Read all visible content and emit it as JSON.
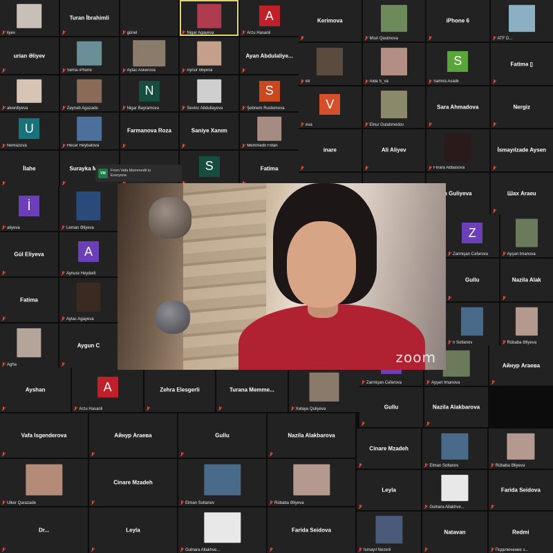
{
  "app": {
    "watermark": "zoom"
  },
  "chat_toast": {
    "avatar": "VM",
    "line1": "From Vafa Memmedli to",
    "line2": "Everyone"
  },
  "colors": {
    "tile": "#222222",
    "active_border": "#e3d66b",
    "mute": "#e0483e"
  },
  "top_grid": [
    {
      "kind": "thumb",
      "caption": "liyev",
      "img": "#c8c0b6"
    },
    {
      "kind": "name",
      "name": "Turan İbrahimli",
      "caption": ""
    },
    {
      "kind": "caption",
      "caption": "günel"
    },
    {
      "kind": "thumb",
      "caption": "Nigar Agayeva",
      "img": "#b03a4e",
      "active": true
    },
    {
      "kind": "letter",
      "letter": "A",
      "bg": "#c0202a",
      "caption": "Arzu Hasanli"
    },
    {
      "kind": "name",
      "name": "urian Əliyev",
      "caption": ""
    },
    {
      "kind": "thumb",
      "caption": "Sema iPhone",
      "img": "#6a8f96"
    },
    {
      "kind": "thumb",
      "caption": "Aytac Askerova",
      "img": "#8a7b6a",
      "wide": true
    },
    {
      "kind": "thumb",
      "caption": "Aynur Əliyeva",
      "img": "#c4a08c"
    },
    {
      "kind": "name",
      "name": "Ayan Abdulaliye...",
      "caption": ""
    },
    {
      "kind": "thumb",
      "caption": "alverdiyeva",
      "img": "#d8c4b4"
    },
    {
      "kind": "thumb",
      "caption": "Zeynəb Agazade",
      "img": "#8a6b5a"
    },
    {
      "kind": "letter",
      "letter": "N",
      "bg": "#164d3e",
      "caption": "Nigar Bayramova"
    },
    {
      "kind": "thumb",
      "caption": "Sevinc Abdullayeva",
      "img": "#cfcfcf"
    },
    {
      "kind": "letter",
      "letter": "S",
      "bg": "#c84a1e",
      "caption": "Şebnem Rustemova"
    },
    {
      "kind": "letter",
      "letter": "U",
      "bg": "#17727a",
      "caption": "Nemazova"
    },
    {
      "kind": "thumb",
      "caption": "Hecər Heybətova",
      "img": "#4c6f9c"
    },
    {
      "kind": "name",
      "name": "Farmanova Roza",
      "caption": ""
    },
    {
      "kind": "name",
      "name": "Saniye Xanım",
      "caption": ""
    },
    {
      "kind": "thumb",
      "caption": "Memmedli Fidan",
      "img": "#a58b82"
    },
    {
      "kind": "name",
      "name": "İlahe",
      "caption": ""
    },
    {
      "kind": "name",
      "name": "Surayka Murad",
      "caption": ""
    },
    {
      "kind": "caption",
      "caption": ""
    },
    {
      "kind": "letter",
      "letter": "S",
      "bg": "#164d3e",
      "caption": ""
    },
    {
      "kind": "name",
      "name": "Fatima",
      "caption": ""
    }
  ],
  "right_grid": [
    {
      "kind": "name",
      "name": "Kerimova",
      "caption": ""
    },
    {
      "kind": "thumb",
      "caption": "Misri Qasimova",
      "img": "#6d8a5a"
    },
    {
      "kind": "name",
      "name": "iPhone 6",
      "caption": ""
    },
    {
      "kind": "thumb",
      "caption": "ATF D...",
      "img": "#8bb0c4"
    },
    {
      "kind": "thumb",
      "caption": "eti",
      "img": "#5b4a3e"
    },
    {
      "kind": "thumb",
      "caption": "Aida S_va",
      "img": "#b28f82"
    },
    {
      "kind": "letter",
      "letter": "S",
      "bg": "#5aa53a",
      "caption": "Samira Asadli"
    },
    {
      "kind": "name",
      "name": "Fatimə ▯",
      "caption": ""
    },
    {
      "kind": "letter",
      "letter": "V",
      "bg": "#d4502a",
      "caption": "eva"
    },
    {
      "kind": "thumb",
      "caption": "Elnur Gulahmedov",
      "img": "#8a8a6a"
    },
    {
      "kind": "name",
      "name": "Sara Ahmadova",
      "caption": ""
    },
    {
      "kind": "name",
      "name": "Nergiz",
      "caption": ""
    },
    {
      "kind": "name",
      "name": "inare",
      "caption": ""
    },
    {
      "kind": "name",
      "name": "Ali Aliyev",
      "caption": ""
    },
    {
      "kind": "thumb",
      "caption": "Finara Abbasova",
      "img": "#2a1a1a"
    },
    {
      "kind": "name",
      "name": "İsmayılzade Aysen",
      "caption": ""
    },
    {
      "kind": "caption",
      "caption": ""
    },
    {
      "kind": "caption",
      "caption": ""
    },
    {
      "kind": "name",
      "name": "n Guliyeva",
      "caption": ""
    },
    {
      "kind": "name",
      "name": "Шах Araeu",
      "caption": ""
    }
  ],
  "left_strip": [
    {
      "kind": "letter",
      "letter": "İ",
      "bg": "#6b3fb8",
      "caption": "aliyeva"
    },
    {
      "kind": "thumb",
      "caption": "Leman Əliyeva",
      "img": "#2a4a7a"
    },
    {
      "kind": "name",
      "name": "Gül Eliyeva",
      "caption": ""
    },
    {
      "kind": "letter",
      "letter": "A",
      "bg": "#6b3fb8",
      "caption": "Aynure Heyderli"
    },
    {
      "kind": "name",
      "name": "Fatima",
      "caption": ""
    },
    {
      "kind": "thumb",
      "caption": "Aytac Agayeva",
      "img": "#3a2a22"
    },
    {
      "kind": "thumb",
      "caption": "Agha",
      "img": "#b4a49a"
    },
    {
      "kind": "name",
      "name": "Aygun C",
      "caption": ""
    }
  ],
  "right_strip": [
    {
      "kind": "letter",
      "letter": "Z",
      "bg": "#6b3fb8",
      "caption": "Zarmişan Cəfərova"
    },
    {
      "kind": "thumb",
      "caption": "Ayşən İmanova",
      "img": "#6a7a5a"
    },
    {
      "kind": "name",
      "name": "Gullu",
      "caption": ""
    },
    {
      "kind": "name",
      "name": "Nazila Alak",
      "caption": ""
    },
    {
      "kind": "thumb",
      "caption": "n Soltanov",
      "img": "#4a6a8a"
    },
    {
      "kind": "thumb",
      "caption": "Rübaba Əliyeva",
      "img": "#b49a8e"
    }
  ],
  "bottom_rows": {
    "row1": [
      {
        "kind": "name",
        "name": "Ayshan",
        "caption": ""
      },
      {
        "kind": "letter",
        "letter": "A",
        "bg": "#c0202a",
        "caption": "Arzu Hasanli"
      },
      {
        "kind": "name",
        "name": "Zehra Elesgerli",
        "caption": ""
      },
      {
        "kind": "name",
        "name": "Turana Memme...",
        "caption": ""
      },
      {
        "kind": "thumb",
        "caption": "Xətayə Quliyeva",
        "img": "#8a7a6a"
      }
    ],
    "row1_right": [
      {
        "kind": "letter",
        "letter": "Z",
        "bg": "#6b3fb8",
        "caption": "Zarmişan Cəfərova"
      },
      {
        "kind": "thumb",
        "caption": "Ayşən İmanova",
        "img": "#6a7a5a"
      },
      {
        "kind": "name",
        "name": "Aйнур Araeвa",
        "caption": ""
      },
      {
        "kind": "name",
        "name": "Gullu",
        "caption": ""
      },
      {
        "kind": "name",
        "name": "Nazila Alakbarova",
        "caption": ""
      }
    ],
    "row2": [
      {
        "kind": "name",
        "name": "Vafa Isgenderova",
        "caption": ""
      },
      {
        "kind": "name",
        "name": "Aйнур Araeвa",
        "caption": ""
      },
      {
        "kind": "name",
        "name": "Gullu",
        "caption": ""
      },
      {
        "kind": "name",
        "name": "Nazila Alakbarova",
        "caption": ""
      }
    ],
    "row2_right": [
      {
        "kind": "name",
        "name": "Cinare Mzadeh",
        "caption": ""
      },
      {
        "kind": "thumb",
        "caption": "Elman Soltanov",
        "img": "#4a6a8a"
      },
      {
        "kind": "thumb",
        "caption": "Rübaba Əliyeva",
        "img": "#b49a8e"
      }
    ],
    "row3": [
      {
        "kind": "thumb",
        "caption": "Ulker Qarazade",
        "img": "#b48a78"
      },
      {
        "kind": "name",
        "name": "Cinare Mzadeh",
        "caption": ""
      },
      {
        "kind": "thumb",
        "caption": "Elman Soltanov",
        "img": "#4a6a8a"
      },
      {
        "kind": "thumb",
        "caption": "Rübaba Əliyeva",
        "img": "#b49a8e"
      }
    ],
    "row3_right": [
      {
        "kind": "name",
        "name": "Leyla",
        "caption": ""
      },
      {
        "kind": "thumb",
        "caption": "Gulnara Allakhve...",
        "img": "#e8e8e8"
      },
      {
        "kind": "name",
        "name": "Farida Seidova",
        "caption": ""
      }
    ],
    "row4": [
      {
        "kind": "name",
        "name": "Dr...",
        "caption": ""
      },
      {
        "kind": "name",
        "name": "Leyla",
        "caption": ""
      },
      {
        "kind": "thumb",
        "caption": "Gulnara Allakhve...",
        "img": "#e8e8e8"
      },
      {
        "kind": "name",
        "name": "Farida Seidova",
        "caption": ""
      }
    ],
    "row4_right": [
      {
        "kind": "thumb",
        "caption": "İsmayıl Nezerli",
        "img": "#4a5a7a"
      },
      {
        "kind": "name",
        "name": "Natavan",
        "caption": ""
      },
      {
        "kind": "name",
        "name": "Redmi",
        "caption": "Подключение з..."
      }
    ]
  }
}
